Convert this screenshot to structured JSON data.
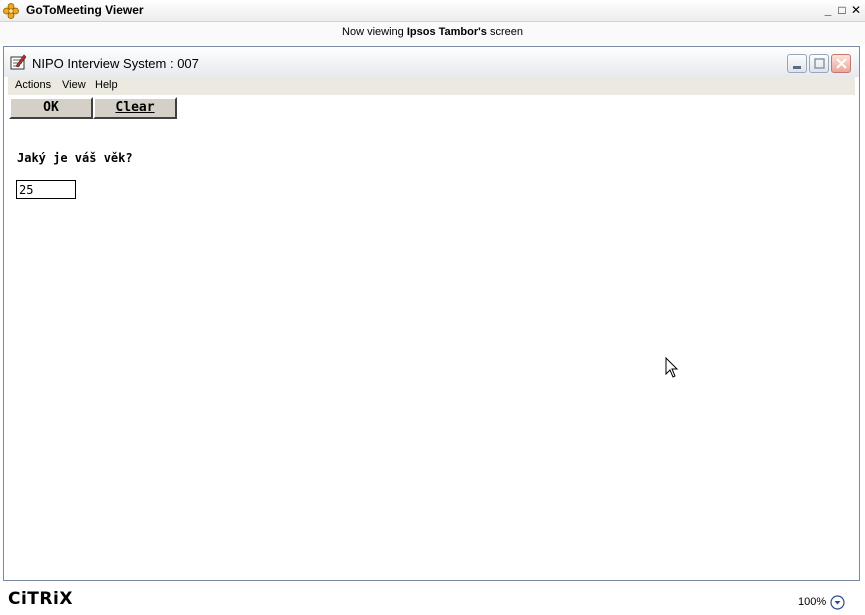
{
  "viewer": {
    "title": "GoToMeeting Viewer",
    "viewing_prefix": "Now viewing ",
    "presenter": "Ipsos Tambor's",
    "viewing_suffix": " screen",
    "controls": {
      "minimize": "_",
      "maximize": "□",
      "close": "✕"
    }
  },
  "app": {
    "title": "NIPO Interview System : 007",
    "menu": [
      "Actions",
      "View",
      "Help"
    ],
    "toolbar": {
      "ok_label": "OK",
      "clear_label": "Clear"
    }
  },
  "question": {
    "text": "Jaký je váš věk?",
    "answer": "25"
  },
  "footer": {
    "brand": "CiTRiX",
    "zoom": "100%"
  },
  "icons": {
    "viewer_logo": "flower-logo-icon",
    "app_icon": "nipo-app-icon",
    "zoom_menu": "chevron-down-circle-icon"
  },
  "colors": {
    "frame_border": "#7a8aa0",
    "menubar_bg": "#ece9e0",
    "button_face": "#d4d0c8",
    "close_button": "#e8a79c"
  }
}
